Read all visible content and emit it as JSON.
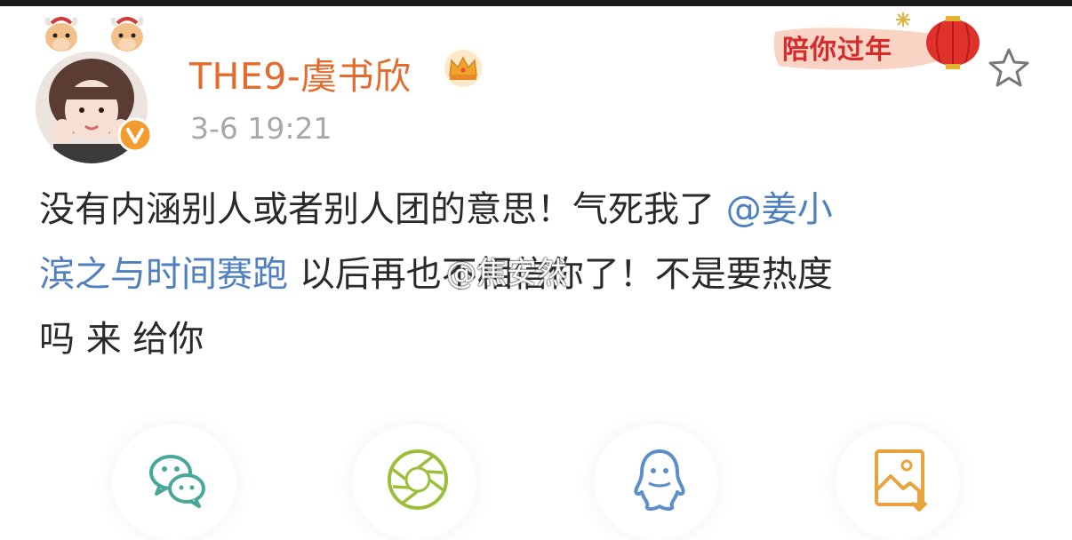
{
  "post": {
    "author": "THE9-虞书欣",
    "timestamp": "3-6 19:21",
    "badge_text": "陪你过年",
    "content": {
      "line1_a": "没有内涵别人或者别人团的意思！气死我了 ",
      "line1_mention": "@姜小",
      "line2_mention": "滨之与时间赛跑",
      "line2_b": " 以后再也不相信你了！不是要热度",
      "line3": "吗 来 给你"
    }
  },
  "watermark": "@焦安然",
  "share": {
    "items": [
      {
        "icon": "wechat-icon"
      },
      {
        "icon": "moments-icon"
      },
      {
        "icon": "qq-icon"
      },
      {
        "icon": "save-image-icon"
      }
    ]
  },
  "colors": {
    "username": "#e36b2c",
    "mention": "#4f7fbf",
    "timestamp": "#a8a8a8",
    "wechat": "#4aa89b",
    "moments": "#9bbf3a",
    "qq": "#5e8ec9",
    "save": "#e8a33d"
  }
}
